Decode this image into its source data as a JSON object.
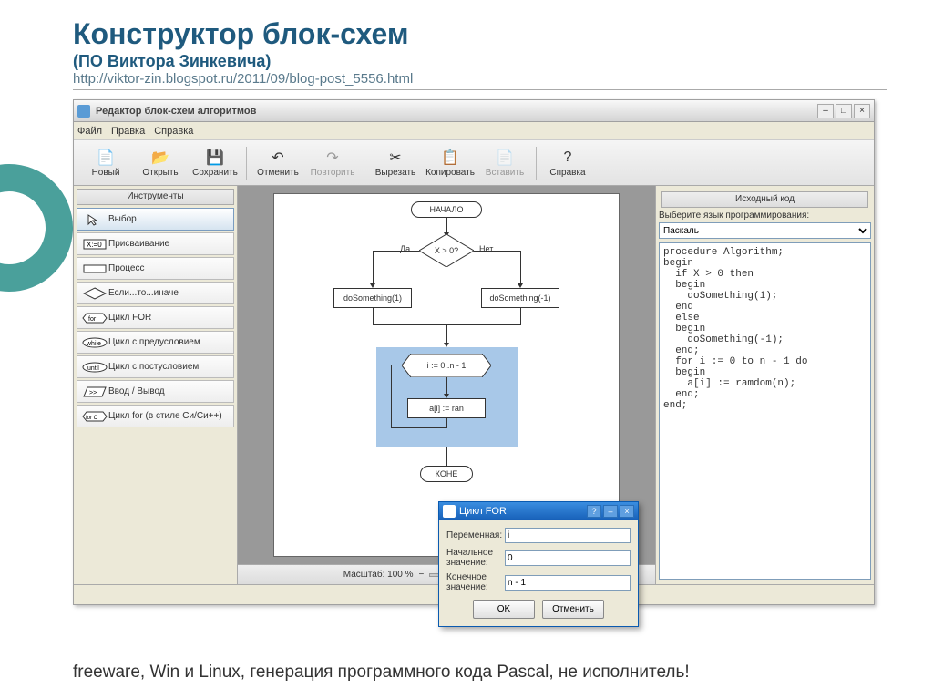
{
  "slide": {
    "title": "Конструктор блок-схем",
    "subtitle": "(ПО Виктора Зинкевича)",
    "url": "http://viktor-zin.blogspot.ru/2011/09/blog-post_5556.html",
    "footer": "freeware, Win и Linux, генерация программного кода Pascal, не исполнитель!"
  },
  "window": {
    "title": "Редактор блок-схем алгоритмов",
    "menu": [
      "Файл",
      "Правка",
      "Справка"
    ],
    "toolbar": [
      {
        "icon": "file-new-icon",
        "label": "Новый",
        "g": "📄"
      },
      {
        "icon": "folder-open-icon",
        "label": "Открыть",
        "g": "📂"
      },
      {
        "icon": "save-icon",
        "label": "Сохранить",
        "g": "💾"
      },
      {
        "sep": true
      },
      {
        "icon": "undo-icon",
        "label": "Отменить",
        "g": "↶"
      },
      {
        "icon": "redo-icon",
        "label": "Повторить",
        "g": "↷",
        "disabled": true
      },
      {
        "sep": true
      },
      {
        "icon": "cut-icon",
        "label": "Вырезать",
        "g": "✂"
      },
      {
        "icon": "copy-icon",
        "label": "Копировать",
        "g": "📋"
      },
      {
        "icon": "paste-icon",
        "label": "Вставить",
        "g": "📄",
        "disabled": true
      },
      {
        "sep": true
      },
      {
        "icon": "help-icon",
        "label": "Справка",
        "g": "?"
      }
    ],
    "left_title": "Инструменты",
    "tools": [
      {
        "label": "Выбор",
        "sel": true
      },
      {
        "label": "Присваивание"
      },
      {
        "label": "Процесс"
      },
      {
        "label": "Если...то...иначе"
      },
      {
        "label": "Цикл FOR"
      },
      {
        "label": "Цикл с предусловием"
      },
      {
        "label": "Цикл с постусловием"
      },
      {
        "label": "Ввод / Вывод"
      },
      {
        "label": "Цикл for (в стиле Си/Си++)"
      }
    ],
    "right_title": "Исходный код",
    "lang_label": "Выберите язык программирования:",
    "lang_value": "Паскаль",
    "zoom_label": "Масштаб: 100 %"
  },
  "flowchart": {
    "start": "НАЧАЛО",
    "cond": "X > 0?",
    "yes": "Да",
    "no": "Нет",
    "proc1": "doSomething(1)",
    "proc2": "doSomething(-1)",
    "loop": "i := 0..n - 1",
    "loopbody": "a[i] := ran",
    "end": "КОНЕ"
  },
  "code": "procedure Algorithm;\nbegin\n  if X > 0 then\n  begin\n    doSomething(1);\n  end\n  else\n  begin\n    doSomething(-1);\n  end;\n  for i := 0 to n - 1 do\n  begin\n    a[i] := ramdom(n);\n  end;\nend;",
  "dialog": {
    "title": "Цикл FOR",
    "rows": [
      {
        "label": "Переменная:",
        "value": "i"
      },
      {
        "label": "Начальное значение:",
        "value": "0"
      },
      {
        "label": "Конечное значение:",
        "value": "n - 1"
      }
    ],
    "ok": "OK",
    "cancel": "Отменить"
  }
}
